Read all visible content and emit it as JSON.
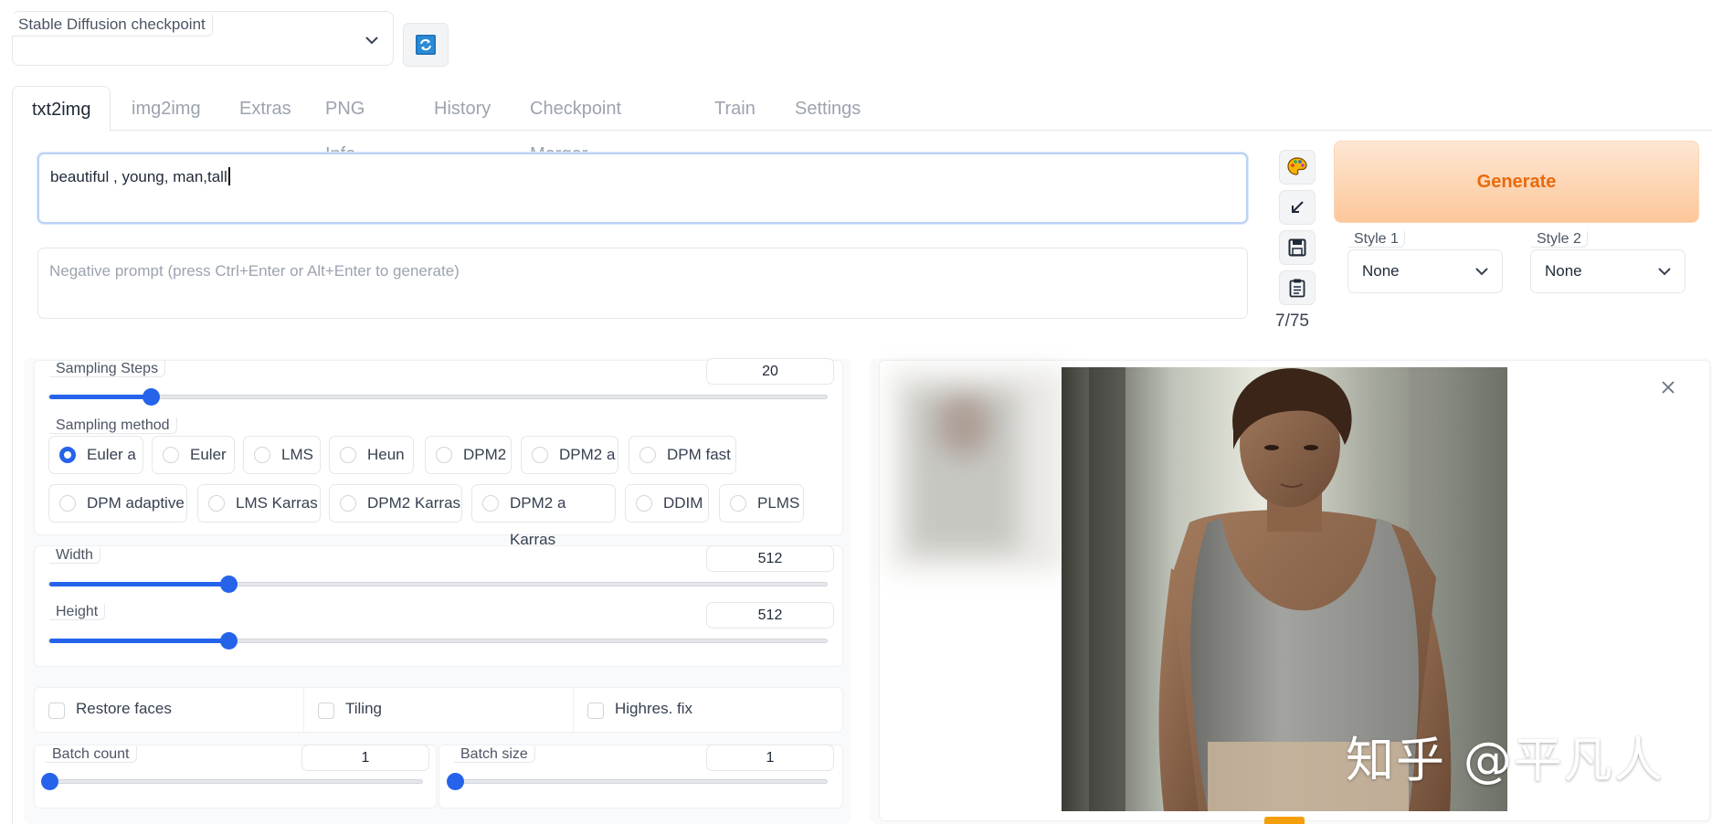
{
  "checkpoint": {
    "label": "Stable Diffusion checkpoint",
    "value": ""
  },
  "tabs": [
    {
      "label": "txt2img"
    },
    {
      "label": "img2img"
    },
    {
      "label": "Extras"
    },
    {
      "label": "PNG Info"
    },
    {
      "label": "History"
    },
    {
      "label": "Checkpoint Merger"
    },
    {
      "label": "Train"
    },
    {
      "label": "Settings"
    }
  ],
  "prompt": {
    "value": "beautiful , young,  man,tall"
  },
  "negative_prompt": {
    "placeholder": "Negative prompt (press Ctrl+Enter or Alt+Enter to generate)"
  },
  "token_count": "7/75",
  "generate_label": "Generate",
  "style1": {
    "label": "Style 1",
    "value": "None"
  },
  "style2": {
    "label": "Style 2",
    "value": "None"
  },
  "sampling_steps": {
    "label": "Sampling Steps",
    "value": "20",
    "fraction": 0.13
  },
  "sampling_method": {
    "label": "Sampling method",
    "options": [
      "Euler a",
      "Euler",
      "LMS",
      "Heun",
      "DPM2",
      "DPM2 a",
      "DPM fast",
      "DPM adaptive",
      "LMS Karras",
      "DPM2 Karras",
      "DPM2 a Karras",
      "DDIM",
      "PLMS"
    ],
    "selected": "Euler a"
  },
  "width": {
    "label": "Width",
    "value": "512",
    "fraction": 0.23
  },
  "height": {
    "label": "Height",
    "value": "512",
    "fraction": 0.23
  },
  "checkboxes": {
    "restore_faces": "Restore faces",
    "tiling": "Tiling",
    "highres_fix": "Highres. fix"
  },
  "batch_count": {
    "label": "Batch count",
    "value": "1",
    "fraction": 0.0
  },
  "batch_size": {
    "label": "Batch size",
    "value": "1",
    "fraction": 0.0
  },
  "watermark": "知乎 @平凡人",
  "colors": {
    "accent": "#2563eb",
    "generate_text": "#ea6a0c",
    "generate_bg": "#fdc79a"
  },
  "icons": [
    "chevron-down-icon",
    "refresh-icon",
    "palette-icon",
    "arrow-icon",
    "save-icon",
    "clipboard-icon",
    "close-icon"
  ]
}
